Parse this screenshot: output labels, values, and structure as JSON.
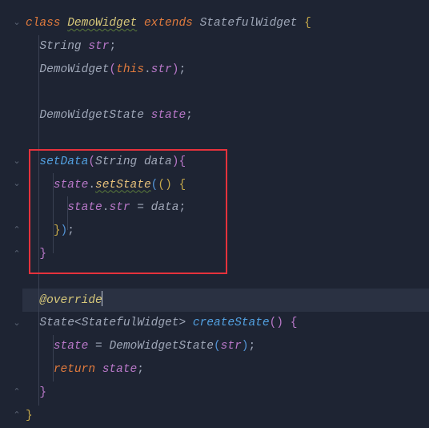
{
  "line1": {
    "kw_class": "class",
    "name": "DemoWidget",
    "kw_extends": "extends",
    "super": "StatefulWidget",
    "brace": "{"
  },
  "line2": {
    "type": "String",
    "name": "str",
    "semi": ";"
  },
  "line3": {
    "ctor": "DemoWidget",
    "lpar": "(",
    "this_kw": "this",
    "dot": ".",
    "field": "str",
    "rpar": ")",
    "semi": ";"
  },
  "line5": {
    "type": "DemoWidgetState",
    "name": "state",
    "semi": ";"
  },
  "line7": {
    "name": "setData",
    "lpar": "(",
    "ptype": "String",
    "pname": "data",
    "rpar": ")",
    "brace": "{"
  },
  "line8": {
    "obj": "state",
    "dot": ".",
    "method": "setState",
    "lpar": "(",
    "lpar2": "(",
    "rpar2": ")",
    "brace": "{"
  },
  "line9": {
    "obj": "state",
    "dot": ".",
    "field": "str",
    "eq": "=",
    "val": "data",
    "semi": ";"
  },
  "line10": {
    "rbrace": "}",
    "rpar": ")",
    "semi": ";"
  },
  "line11": {
    "rbrace": "}"
  },
  "line13": {
    "annotation": "@override"
  },
  "line14": {
    "type": "State",
    "lt": "<",
    "gtype": "StatefulWidget",
    "gt": ">",
    "name": "createState",
    "lpar": "(",
    "rpar": ")",
    "brace": "{"
  },
  "line15": {
    "lhs": "state",
    "eq": "=",
    "ctor": "DemoWidgetState",
    "lpar": "(",
    "arg": "str",
    "rpar": ")",
    "semi": ";"
  },
  "line16": {
    "kw": "return",
    "val": "state",
    "semi": ";"
  },
  "line17": {
    "rbrace": "}"
  },
  "line18": {
    "rbrace": "}"
  }
}
